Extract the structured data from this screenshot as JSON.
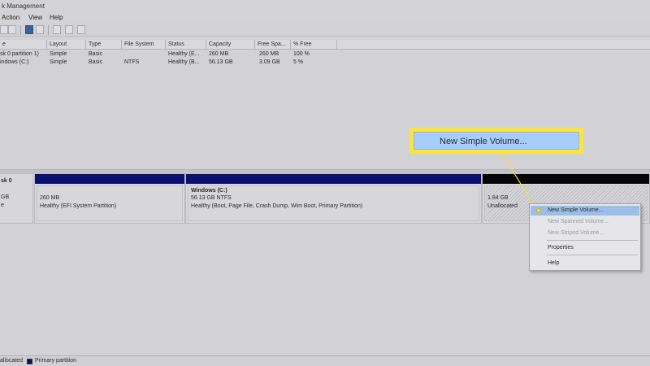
{
  "window": {
    "title": "k Management"
  },
  "menu": [
    "Action",
    "View",
    "Help"
  ],
  "volume_list": {
    "columns": [
      "e",
      "Layout",
      "Type",
      "File System",
      "Status",
      "Capacity",
      "Free Spa...",
      "% Free"
    ],
    "rows": [
      [
        "sk 0 partition 1)",
        "Simple",
        "Basic",
        "",
        "Healthy (E...",
        "260 MB",
        "260 MB",
        "100 %"
      ],
      [
        "indows (C:)",
        "Simple",
        "Basic",
        "NTFS",
        "Healthy (B...",
        "56.13 GB",
        "3.09 GB",
        "5 %"
      ]
    ]
  },
  "disk": {
    "label_title": "sk 0",
    "label_size": "GB",
    "label_status": "e",
    "partitions": [
      {
        "title": "",
        "line1": "260 MB",
        "line2": "Healthy (EFI System Partition)"
      },
      {
        "title": "Windows  (C:)",
        "line1": "56.13 GB NTFS",
        "line2": "Healthy (Boot, Page File, Crash Dump, Wim Boot, Primary Partition)"
      },
      {
        "title": "",
        "line1": "1.84 GB",
        "line2": "Unallocated"
      }
    ]
  },
  "legend": {
    "unallocated": "allocated",
    "primary": "Primary partition"
  },
  "callout": {
    "label": "New Simple Volume..."
  },
  "context_menu": {
    "new_simple": "New Simple Volume...",
    "new_spanned": "New Spanned Volume...",
    "new_striped": "New Striped Volume...",
    "properties": "Properties",
    "help": "Help"
  },
  "colors": {
    "primary_partition": "#0b0f6e",
    "unallocated_bar": "#060606",
    "callout_border": "#fde43a",
    "callout_fill": "#a8cdfa",
    "highlight": "#9bbfe8"
  },
  "icons": [
    "back-icon",
    "forward-icon",
    "properties-icon",
    "help-icon",
    "refresh-icon",
    "disk-icon",
    "check-icon"
  ]
}
